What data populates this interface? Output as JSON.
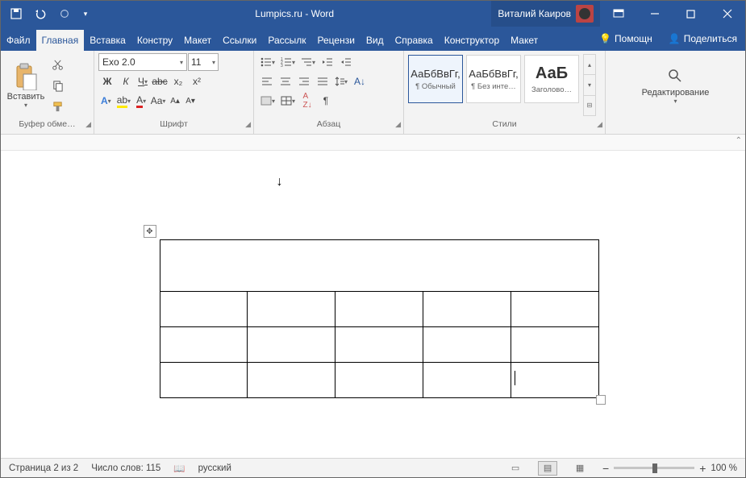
{
  "title": "Lumpics.ru  -  Word",
  "user": {
    "name": "Виталий Каиров"
  },
  "tabs": [
    {
      "label": "Файл"
    },
    {
      "label": "Главная"
    },
    {
      "label": "Вставка"
    },
    {
      "label": "Констру"
    },
    {
      "label": "Макет"
    },
    {
      "label": "Ссылки"
    },
    {
      "label": "Рассылк"
    },
    {
      "label": "Рецензи"
    },
    {
      "label": "Вид"
    },
    {
      "label": "Справка"
    },
    {
      "label": "Конструктор"
    },
    {
      "label": "Макет"
    }
  ],
  "tabs_right": {
    "help": "Помощн",
    "share": "Поделиться"
  },
  "clipboard": {
    "group_label": "Буфер обме…",
    "paste_label": "Вставить"
  },
  "font": {
    "group_label": "Шрифт",
    "name": "Exo 2.0",
    "size": "11",
    "bold": "Ж",
    "italic": "К",
    "underline": "Ч",
    "strike": "abc",
    "sub": "x₂",
    "sup": "x²"
  },
  "paragraph": {
    "group_label": "Абзац"
  },
  "styles": {
    "group_label": "Стили",
    "preview_text": "АаБбВвГг,",
    "preview_big": "АаБ",
    "items": [
      {
        "name": "¶ Обычный"
      },
      {
        "name": "¶ Без инте…"
      },
      {
        "name": "Заголово…"
      }
    ]
  },
  "editing": {
    "group_label": "Редактирование"
  },
  "status": {
    "page": "Страница 2 из 2",
    "words": "Число слов: 115",
    "lang": "русский",
    "zoom": "100 %"
  }
}
